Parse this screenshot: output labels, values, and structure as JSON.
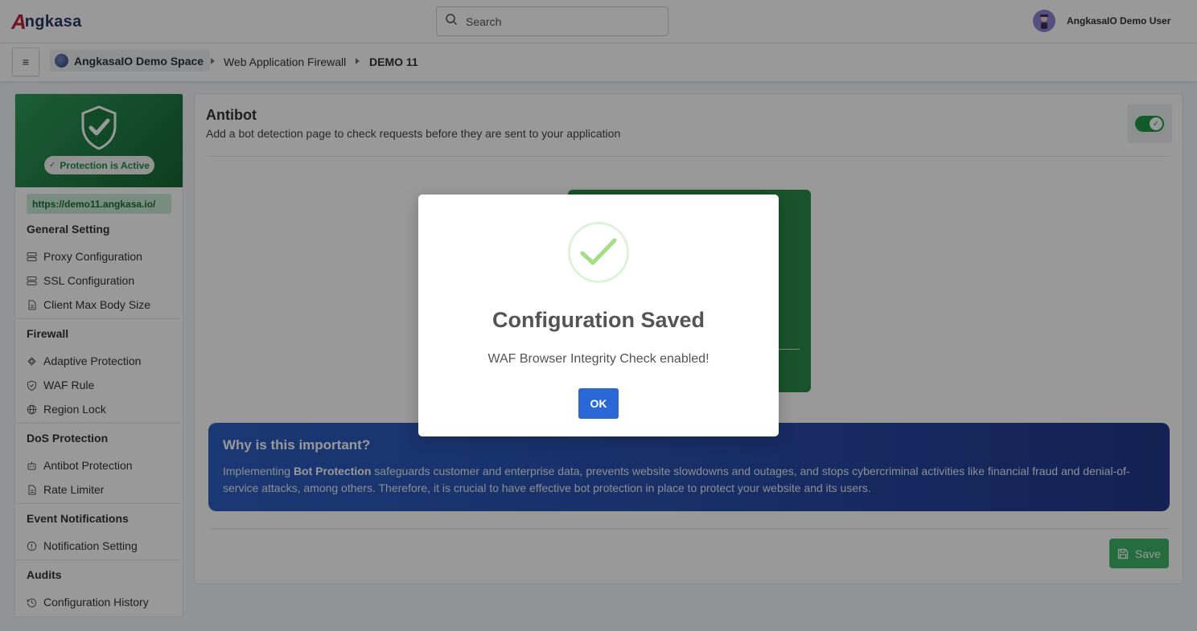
{
  "header": {
    "logo_text": "ngkasa",
    "logo_initial": "A",
    "search_placeholder": "Search",
    "user_name": "AngkasaIO Demo User"
  },
  "breadcrumb": {
    "space": "AngkasaIO Demo Space",
    "section": "Web Application Firewall",
    "current": "DEMO 11"
  },
  "sidebar": {
    "status_label": "Protection is Active",
    "site_url": "https://demo11.angkasa.io/",
    "sections": [
      {
        "title": "General Setting",
        "items": [
          "Proxy Configuration",
          "SSL Configuration",
          "Client Max Body Size"
        ]
      },
      {
        "title": "Firewall",
        "items": [
          "Adaptive Protection",
          "WAF Rule",
          "Region Lock"
        ]
      },
      {
        "title": "DoS Protection",
        "items": [
          "Antibot Protection",
          "Rate Limiter"
        ]
      },
      {
        "title": "Event Notifications",
        "items": [
          "Notification Setting"
        ]
      },
      {
        "title": "Audits",
        "items": [
          "Configuration History"
        ]
      }
    ]
  },
  "main": {
    "title": "Antibot",
    "subtitle": "Add a bot detection page to check requests before they are sent to your application",
    "toggle_on": true,
    "why": {
      "title": "Why is this important?",
      "body_prefix": "Implementing ",
      "body_bold": "Bot Protection",
      "body_rest": " safeguards customer and enterprise data, prevents website slowdowns and outages, and stops cybercriminal activities like financial fraud and denial-of-service attacks, among others. Therefore, it is crucial to have effective bot protection in place to protect your website and its users."
    },
    "save_label": "Save"
  },
  "modal": {
    "title": "Configuration Saved",
    "message": "WAF Browser Integrity Check enabled!",
    "ok_label": "OK"
  },
  "colors": {
    "brand_green": "#1f9a4a",
    "why_blue": "#2a4fae",
    "ok_blue": "#2a68d8",
    "success_check": "#a5dc86"
  }
}
